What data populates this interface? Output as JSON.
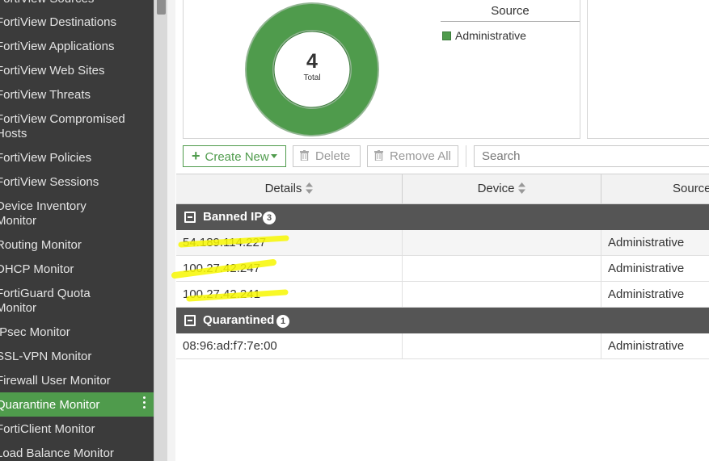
{
  "sidebar": {
    "items": [
      {
        "label": "FortiView Sources"
      },
      {
        "label": "FortiView Destinations"
      },
      {
        "label": "FortiView Applications"
      },
      {
        "label": "FortiView Web Sites"
      },
      {
        "label": "FortiView Threats"
      },
      {
        "label": "FortiView Compromised",
        "label2": "Hosts"
      },
      {
        "label": "FortiView Policies"
      },
      {
        "label": "FortiView Sessions"
      },
      {
        "label": "Device Inventory",
        "label2": "Monitor"
      },
      {
        "label": "Routing Monitor"
      },
      {
        "label": "DHCP Monitor"
      },
      {
        "label": "FortiGuard Quota",
        "label2": "Monitor"
      },
      {
        "label": "IPsec Monitor"
      },
      {
        "label": "SSL-VPN Monitor"
      },
      {
        "label": "Firewall User Monitor"
      },
      {
        "label": "Quarantine Monitor",
        "active": true
      },
      {
        "label": "FortiClient Monitor"
      },
      {
        "label": "Load Balance Monitor"
      }
    ]
  },
  "chart": {
    "total": "4",
    "total_label": "Total",
    "legend_title": "Source",
    "legend_items": [
      "Administrative"
    ],
    "color": "#4f9b4c"
  },
  "chart_data": {
    "type": "pie",
    "categories": [
      "Administrative"
    ],
    "values": [
      4
    ],
    "title": ""
  },
  "toolbar": {
    "create_label": "Create New",
    "delete_label": "Delete",
    "remove_all_label": "Remove All",
    "search_placeholder": "Search"
  },
  "table": {
    "columns": [
      "Details",
      "Device",
      "Source"
    ],
    "groups": [
      {
        "name": "Banned IP",
        "count": "3",
        "rows": [
          {
            "details": "54.189.114.227",
            "device": "",
            "source": "Administrative"
          },
          {
            "details": "100.27.42.247",
            "device": "",
            "source": "Administrative"
          },
          {
            "details": "100.27.42.241",
            "device": "",
            "source": "Administrative"
          }
        ]
      },
      {
        "name": "Quarantined",
        "count": "1",
        "rows": [
          {
            "details": "08:96:ad:f7:7e:00",
            "device": "",
            "source": "Administrative"
          }
        ]
      }
    ]
  },
  "colors": {
    "accent": "#4f9b4c",
    "sidebar_bg": "#3b3b3b",
    "group_bar": "#555555",
    "highlight": "#f7f700"
  }
}
